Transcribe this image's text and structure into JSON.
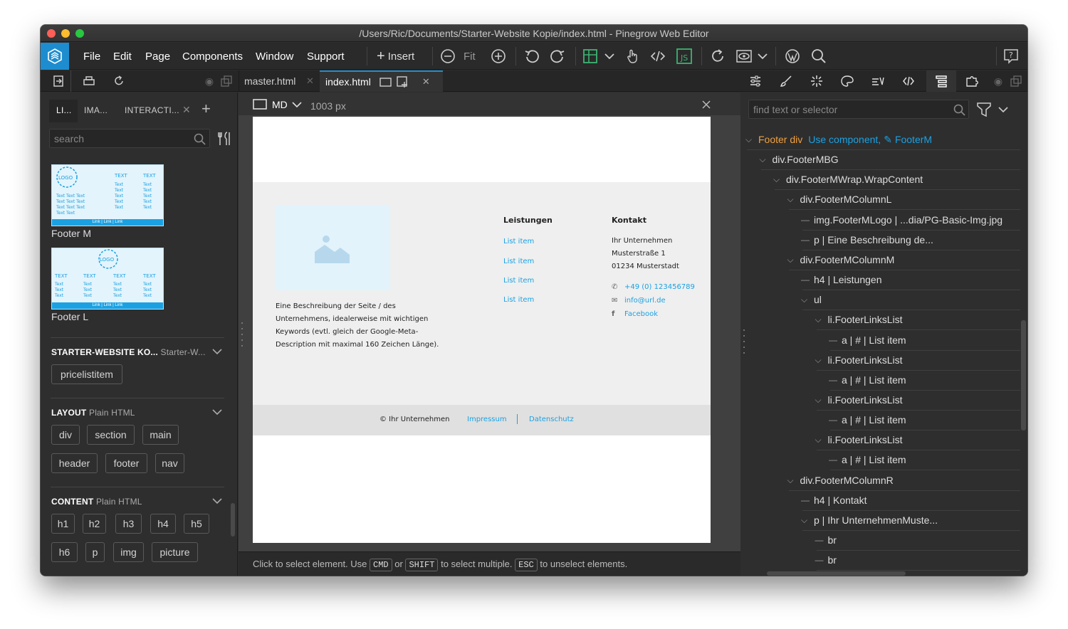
{
  "window": {
    "title": "/Users/Ric/Documents/Starter-Website Kopie/index.html - Pinegrow Web Editor"
  },
  "menu": [
    "File",
    "Edit",
    "Page",
    "Components",
    "Window",
    "Support"
  ],
  "toolbar": {
    "insert": "Insert",
    "fit": "Fit"
  },
  "tabs": {
    "master": "master.html",
    "index": "index.html"
  },
  "left_tabs": {
    "lib": "LI...",
    "images": "IMA...",
    "interactions": "INTERACTI..."
  },
  "library": {
    "search_placeholder": "search",
    "footer_m": "Footer M",
    "footer_l": "Footer L",
    "thumb_logo": "LOGO",
    "thumb_text": "TEXT",
    "thumb_small": "Text",
    "thumb_links": "Link | Link | Link",
    "starter_title": "STARTER-WEBSITE KO...",
    "starter_sub": "Starter-W...",
    "starter_items": [
      "pricelistitem"
    ],
    "layout_title": "LAYOUT",
    "layout_sub": "Plain HTML",
    "layout_items": [
      "div",
      "section",
      "main",
      "header",
      "footer",
      "nav"
    ],
    "content_title": "CONTENT",
    "content_sub": "Plain HTML",
    "content_items": [
      "h1",
      "h2",
      "h3",
      "h4",
      "h5",
      "h6",
      "p",
      "img",
      "picture"
    ]
  },
  "canvas": {
    "size": "MD",
    "width": "1003 px",
    "description": "Eine Beschreibung der Seite / des Unternehmens, idealerweise mit wichtigen Keywords (evtl. gleich der Google-Meta-Description mit maximal 160 Zeichen Länge).",
    "leistungen_title": "Leistungen",
    "list_items": [
      "List item",
      "List item",
      "List item",
      "List item"
    ],
    "kontakt_title": "Kontakt",
    "address": [
      "Ihr Unternehmen",
      "Musterstraße 1",
      "01234 Musterstadt"
    ],
    "phone": "+49 (0) 123456789",
    "email": "info@url.de",
    "facebook": "Facebook",
    "copyright": "© Ihr Unternehmen",
    "impressum": "Impressum",
    "datenschutz": "Datenschutz"
  },
  "status": {
    "p1": "Click to select element. Use",
    "cmd": "CMD",
    "or": "or",
    "shift": "SHIFT",
    "p2": "to select multiple.",
    "esc": "ESC",
    "p3": "to unselect elements."
  },
  "tree": {
    "find_placeholder": "find text or selector",
    "footer_tag": "Footer div",
    "use_component": "Use component,",
    "component_name": "FooterM",
    "nodes": [
      {
        "label": "div.FooterMBG"
      },
      {
        "label": "div.FooterMWrap.WrapContent"
      },
      {
        "label": "div.FooterMColumnL"
      },
      {
        "label": "img.FooterMLogo | ...dia/PG-Basic-Img.jpg"
      },
      {
        "label": "p | Eine Beschreibung de..."
      },
      {
        "label": "div.FooterMColumnM"
      },
      {
        "label": "h4 | Leistungen"
      },
      {
        "label": "ul"
      },
      {
        "label": "li.FooterLinksList"
      },
      {
        "label": "a | # | List item"
      },
      {
        "label": "li.FooterLinksList"
      },
      {
        "label": "a | # | List item"
      },
      {
        "label": "li.FooterLinksList"
      },
      {
        "label": "a | # | List item"
      },
      {
        "label": "li.FooterLinksList"
      },
      {
        "label": "a | # | List item"
      },
      {
        "label": "div.FooterMColumnR"
      },
      {
        "label": "h4 | Kontakt"
      },
      {
        "label": "p | Ihr UnternehmenMuste..."
      },
      {
        "label": "br"
      },
      {
        "label": "br"
      }
    ]
  },
  "colors": {
    "accent": "#1e8dd0",
    "link": "#1ba1e2",
    "footer_tag": "#f0a040"
  }
}
